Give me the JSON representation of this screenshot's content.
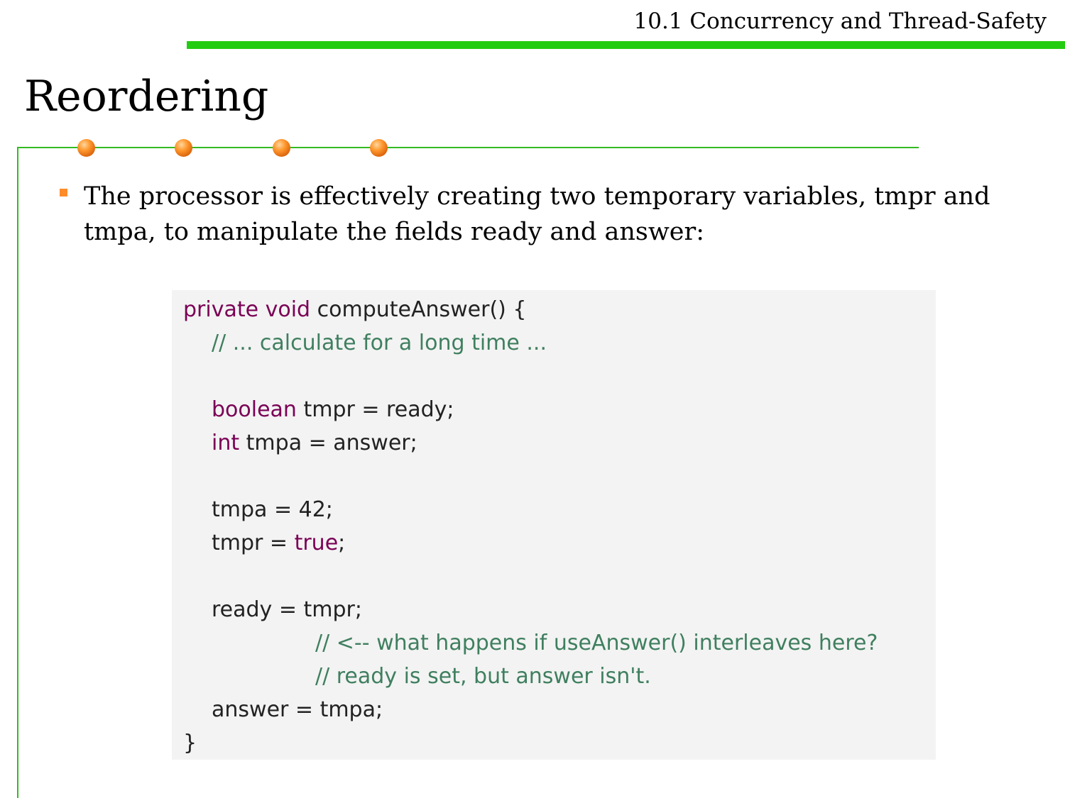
{
  "header": {
    "section_title": "10.1 Concurrency and Thread-Safety",
    "bar_color": "#22cc11"
  },
  "slide": {
    "title": "Reordering",
    "decoration_color": "#ff8c2a"
  },
  "bullet": {
    "text": "The processor is effectively creating two temporary variables, tmpr and tmpa, to manipulate the fields ready and answer:"
  },
  "code": {
    "line1": {
      "kw": "private void",
      "rest": " computeAnswer() {"
    },
    "line2": {
      "comment": "// ... calculate for a long time ..."
    },
    "line4": {
      "kw": "boolean",
      "rest": " tmpr = ready;"
    },
    "line5": {
      "kw": "int",
      "rest": " tmpa = answer;"
    },
    "line7": {
      "text": "tmpa = 42;"
    },
    "line8": {
      "pre": "tmpr = ",
      "kw": "true",
      "post": ";"
    },
    "line10": {
      "text": "ready = tmpr;"
    },
    "line11": {
      "comment": "// <-- what happens if useAnswer() interleaves here?"
    },
    "line12": {
      "comment": "// ready is set, but answer isn't."
    },
    "line13": {
      "text": "answer = tmpa;"
    },
    "line14": {
      "text": "}"
    }
  }
}
